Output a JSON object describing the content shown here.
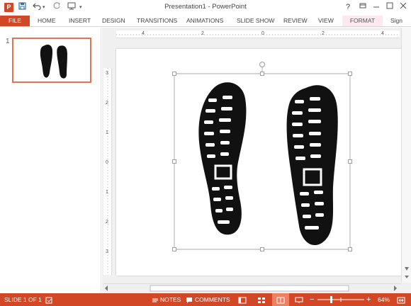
{
  "window": {
    "title": "Presentation1 - PowerPoint",
    "app_icon": "P",
    "controls": [
      "?",
      "restore-icon",
      "minimize-icon",
      "maximize-icon",
      "close-icon"
    ]
  },
  "quick_access": {
    "icons": [
      "save-icon",
      "undo-icon",
      "redo-icon",
      "start-from-beginning-icon",
      "customize-qat-icon"
    ]
  },
  "ribbon": {
    "tabs": [
      {
        "label": "FILE"
      },
      {
        "label": "HOME"
      },
      {
        "label": "INSERT"
      },
      {
        "label": "DESIGN"
      },
      {
        "label": "TRANSITIONS"
      },
      {
        "label": "ANIMATIONS"
      },
      {
        "label": "SLIDE SHOW"
      },
      {
        "label": "REVIEW"
      },
      {
        "label": "VIEW"
      },
      {
        "label": "FORMAT"
      }
    ],
    "sign_in": "Sign"
  },
  "thumbnails": [
    {
      "number": "1"
    }
  ],
  "ruler": {
    "horizontal_labels": [
      "4",
      "2",
      "0",
      "2",
      "4"
    ],
    "vertical_labels": [
      "3",
      "2",
      "1",
      "0",
      "1",
      "2",
      "3"
    ]
  },
  "status": {
    "slide_label": "SLIDE 1 OF 1",
    "notes_label": "NOTES",
    "comments_label": "COMMENTS",
    "zoom_percent": "64%",
    "zoom_minus": "−",
    "zoom_plus": "+",
    "view_icons": [
      "normal-view-icon",
      "slide-sorter-icon",
      "reading-view-icon",
      "slide-show-icon"
    ]
  },
  "colors": {
    "accent": "#d24726",
    "format_tab": "#fde9ef",
    "selection_outline": "#e07552"
  },
  "icons": {
    "spell_check": "spell-check-icon",
    "fit_slide": "fit-slide-icon"
  }
}
